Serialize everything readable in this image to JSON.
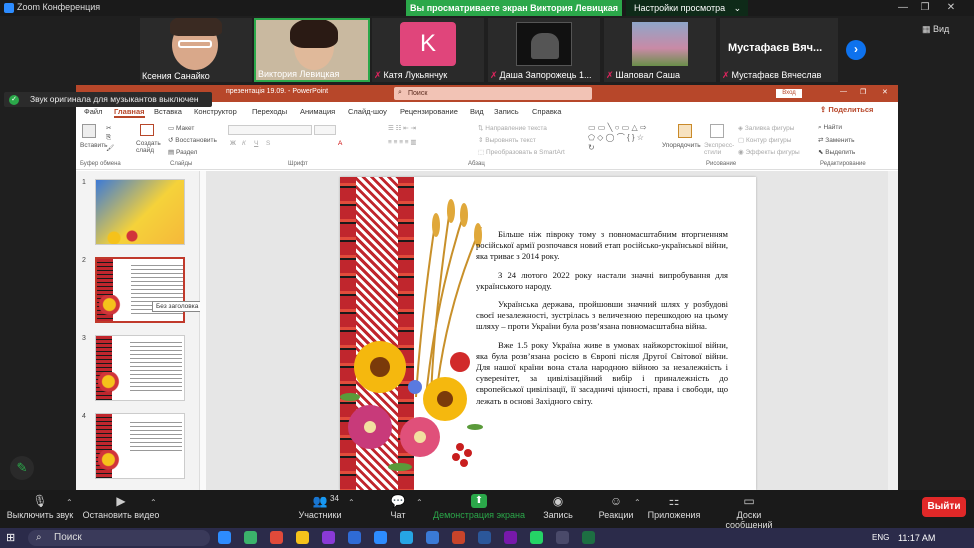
{
  "titlebar": {
    "title": "Zoom Конференция",
    "share_banner": "Вы просматриваете экран Виктория Левицкая",
    "view_settings": "Настройки просмотра"
  },
  "gallery": {
    "participants": [
      {
        "name": "Ксения Санайко"
      },
      {
        "name": "Виктория Левицкая"
      },
      {
        "name": "Катя Лукьянчук",
        "avatar_letter": "K"
      },
      {
        "name": "Даша Запорожець 1..."
      },
      {
        "name": "Шаповал Саша"
      },
      {
        "name": "Мустафаєв Вячеслав"
      }
    ],
    "big_name": "Мустафаєв Вяч...",
    "view_label": "Вид"
  },
  "notification": "Звук оригинала для музыкантов выключен",
  "powerpoint": {
    "title": "презентація 19.09.  -  PowerPoint",
    "search_placeholder": "Поиск",
    "view_btn": "Вход",
    "tabs": [
      "Файл",
      "Главная",
      "Вставка",
      "Конструктор",
      "Переходы",
      "Анимация",
      "Слайд-шоу",
      "Рецензирование",
      "Вид",
      "Запись",
      "Справка"
    ],
    "share_label": "Поделиться",
    "ribbon": {
      "paste": "Вставить",
      "clipboard_group": "Буфер обмена",
      "create_slide": "Создать слайд",
      "layout": "Макет",
      "restore": "Восстановить",
      "section": "Раздел",
      "slides_group": "Слайды",
      "font_group": "Шрифт",
      "text_direction": "Направление текста",
      "align_text": "Выровнять текст",
      "smartart": "Преобразовать в SmartArt",
      "paragraph_group": "Абзац",
      "arrange": "Упорядочить",
      "quick_styles": "Экспресс-стили",
      "shape_fill": "Заливка фигуры",
      "shape_outline": "Контур фигуры",
      "shape_effects": "Эффекты фигуры",
      "drawing_group": "Рисование",
      "find": "Найти",
      "replace": "Заменить",
      "select": "Выделить",
      "editing_group": "Редактирование"
    },
    "thumb_numbers": [
      "1",
      "2",
      "3",
      "4"
    ],
    "tooltip": "Без заголовка",
    "slide_paragraphs": [
      "Більше ніж півроку тому з повномасштабним вторгненням російської армії розпочався новий етап російсько-української війни, яка триває з 2014 року.",
      "З 24  лютого 2022 року настали значні випробування для українського народу.",
      "Українська держава, пройшовши значний шлях у розбудові своєї незалежності, зустрілась з величезною перешкодою на цьому шляху – проти України була розв’язана повномасштабна війна.",
      "Вже 1.5 року Україна живе в умовах найжорстокішої війни, яка була розв’язана росією в Європі після Другої Світової війни. Для нашої країни вона стала народною війною за незалежність і суверенітет, за цивілізаційний вибір і приналежність до європейської цивілізації, її засадничі цінності, права і свободи, що лежать в основі Західного світу."
    ]
  },
  "toolbar": {
    "mute": "Выключить звук",
    "video": "Остановить видео",
    "participants": "Участники",
    "participants_count": "34",
    "chat": "Чат",
    "share": "Демонстрация экрана",
    "record": "Запись",
    "reactions": "Реакции",
    "apps": "Приложения",
    "whiteboards": "Доски сообщений",
    "leave": "Выйти"
  },
  "taskbar": {
    "search": "Поиск",
    "lang": "ENG",
    "time": "11:17 AM"
  },
  "colors": {
    "zoom_green": "#2ba84a",
    "ppt_red": "#b7472a",
    "zoom_blue": "#0e72ed",
    "leave_red": "#e02828"
  }
}
